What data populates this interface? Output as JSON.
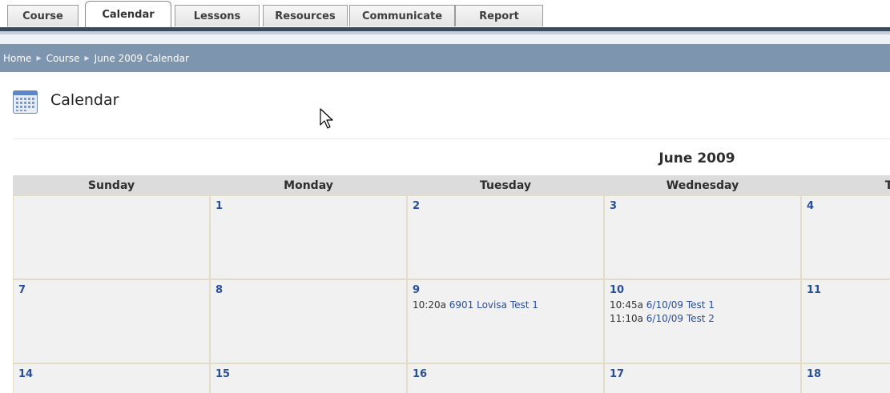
{
  "tabs": [
    "Course",
    "Calendar",
    "Lessons",
    "Resources",
    "Communicate",
    "Report"
  ],
  "active_tab": "Calendar",
  "breadcrumb": {
    "home": "Home",
    "course": "Course",
    "current": "June 2009 Calendar"
  },
  "page_title": "Calendar",
  "month_title": "June 2009",
  "weekdays": [
    "Sunday",
    "Monday",
    "Tuesday",
    "Wednesday",
    "Thur"
  ],
  "weeks": [
    {
      "days": [
        "",
        "1",
        "2",
        "3",
        "4"
      ]
    },
    {
      "days": [
        "7",
        "8",
        "9",
        "10",
        "11"
      ]
    },
    {
      "days": [
        "14",
        "15",
        "16",
        "17",
        "18"
      ]
    }
  ],
  "events": {
    "tue_9": [
      {
        "time": "10:20a",
        "title": "6901 Lovisa Test 1"
      }
    ],
    "wed_10": [
      {
        "time": "10:45a",
        "title": "6/10/09 Test 1"
      },
      {
        "time": "11:10a",
        "title": "6/10/09 Test 2"
      }
    ]
  },
  "colors": {
    "breadcrumb_bg": "#7e95b0",
    "link": "#2a4f9a",
    "header_bg": "#dcdcdc",
    "cell_bg": "#f1f1f1",
    "cell_border": "#e3dcc6"
  }
}
